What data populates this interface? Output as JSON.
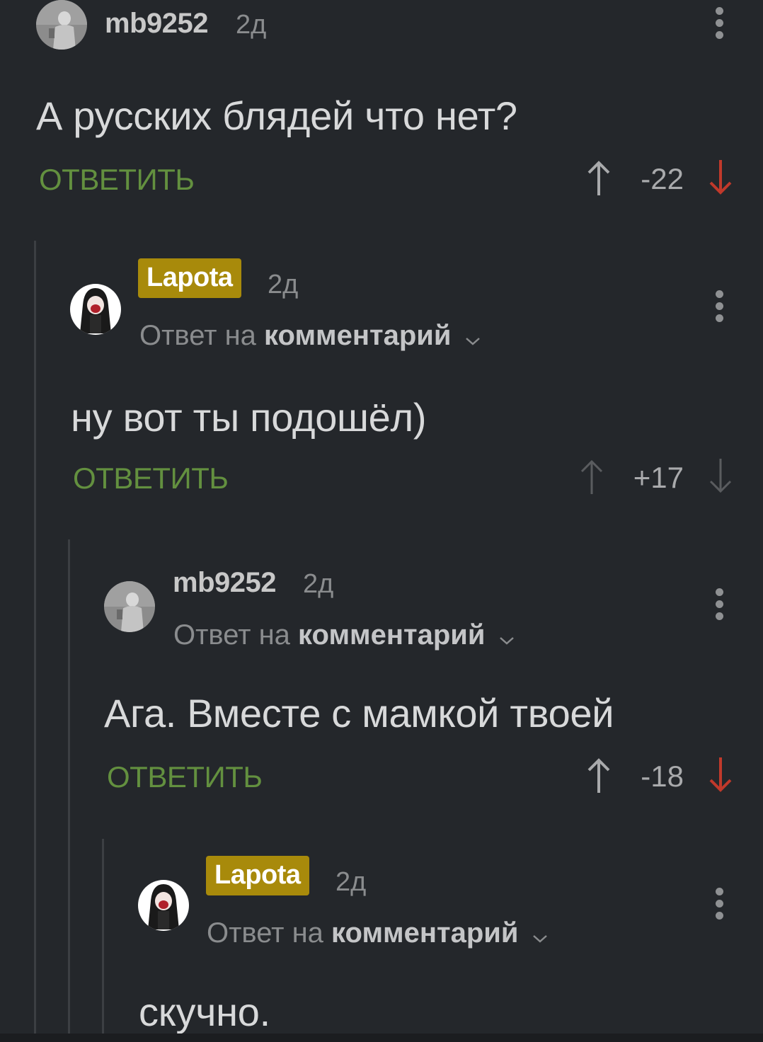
{
  "comments": [
    {
      "username": "mb9252",
      "time": "2д",
      "text": "А русских блядей что нет?",
      "reply_label": "ОТВЕТИТЬ",
      "rating": "-22"
    },
    {
      "username": "Lapota",
      "time": "2д",
      "reply_to_prefix": "Ответ на",
      "reply_to_link": "комментарий",
      "text": "ну вот ты подошёл)",
      "reply_label": "ОТВЕТИТЬ",
      "rating": "+17"
    },
    {
      "username": "mb9252",
      "time": "2д",
      "reply_to_prefix": "Ответ на",
      "reply_to_link": "комментарий",
      "text": "Ага. Вместе с мамкой твоей",
      "reply_label": "ОТВЕТИТЬ",
      "rating": "-18"
    },
    {
      "username": "Lapota",
      "time": "2д",
      "reply_to_prefix": "Ответ на",
      "reply_to_link": "комментарий",
      "text": "скучно."
    }
  ],
  "colors": {
    "background": "#24272b",
    "reply_green": "#63903f",
    "downvote_red": "#c0392b",
    "badge_gold": "#a88a0b",
    "thread_line": "#3c3f43"
  },
  "icons": {
    "upvote": "arrow-up-icon",
    "downvote": "arrow-down-icon",
    "menu": "more-vertical-icon",
    "expand": "chevron-down-icon"
  }
}
